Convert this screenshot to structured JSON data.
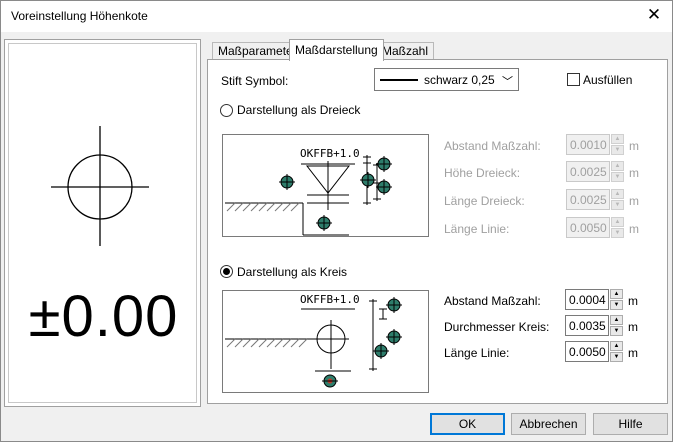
{
  "window": {
    "title": "Voreinstellung Höhenkote"
  },
  "preview": {
    "value": "±0.00"
  },
  "tabs": [
    {
      "label": "Maßparameter"
    },
    {
      "label": "Maßdarstellung"
    },
    {
      "label": "Maßzahl"
    }
  ],
  "pen": {
    "label": "Stift Symbol:",
    "value": "schwarz 0,25"
  },
  "fill": {
    "label": "Ausfüllen",
    "checked": false
  },
  "triangle": {
    "radio_label": "Darstellung als Dreieck",
    "checked": false,
    "sketch_text": "OKFFB+1.0",
    "fields": [
      {
        "label": "Abstand Maßzahl:",
        "value": "0.0010",
        "unit": "m"
      },
      {
        "label": "Höhe Dreieck:",
        "value": "0.0025",
        "unit": "m"
      },
      {
        "label": "Länge Dreieck:",
        "value": "0.0025",
        "unit": "m"
      },
      {
        "label": "Länge Linie:",
        "value": "0.0050",
        "unit": "m"
      }
    ]
  },
  "circle": {
    "radio_label": "Darstellung als Kreis",
    "checked": true,
    "sketch_text": "OKFFB+1.0",
    "fields": [
      {
        "label": "Abstand Maßzahl:",
        "value": "0.0004",
        "unit": "m"
      },
      {
        "label": "Durchmesser Kreis:",
        "value": "0.0035",
        "unit": "m"
      },
      {
        "label": "Länge Linie:",
        "value": "0.0050",
        "unit": "m"
      }
    ]
  },
  "buttons": {
    "ok": "OK",
    "cancel": "Abbrechen",
    "help": "Hilfe"
  },
  "colors": {
    "accent": "#0078d7",
    "marker_fill": "#2e7d6b",
    "marker_dot": "#c0392b"
  }
}
